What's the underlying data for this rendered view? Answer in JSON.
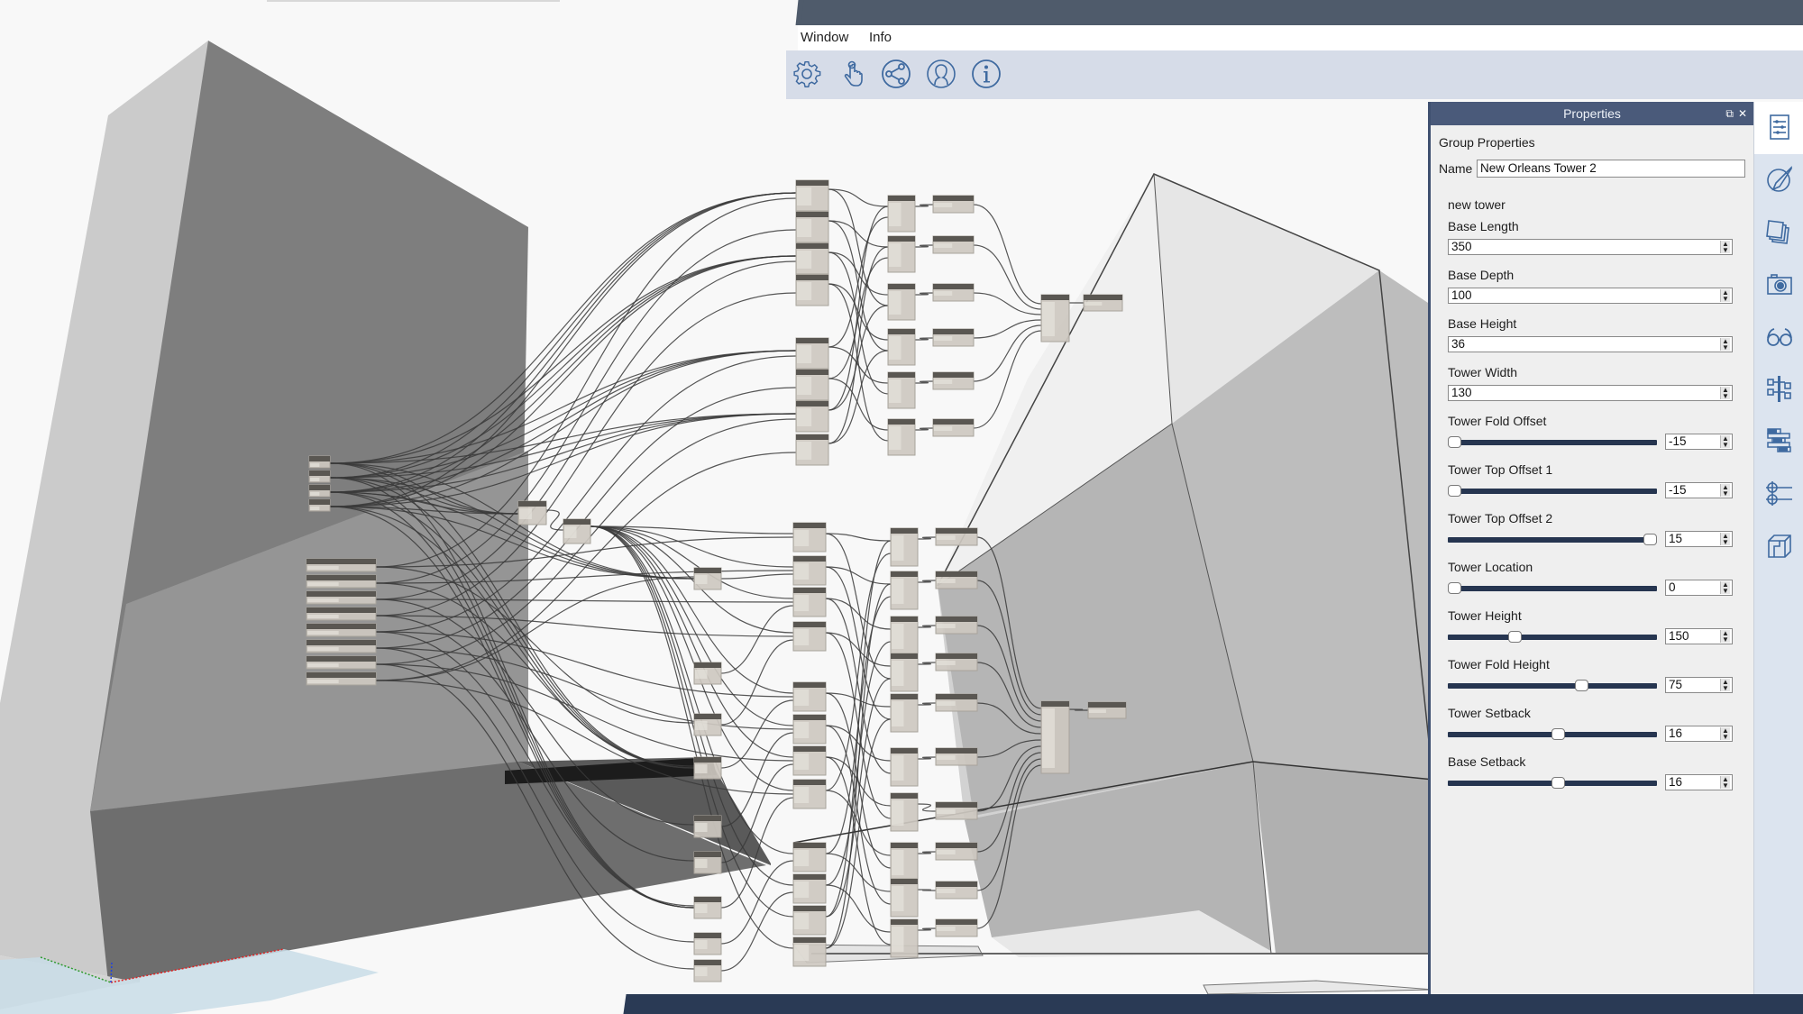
{
  "window": {
    "controls": {
      "minimize": "–",
      "restore": "❐",
      "close": "✕"
    }
  },
  "menu": {
    "items": [
      {
        "label": "Window"
      },
      {
        "label": "Info"
      }
    ]
  },
  "toolbar": {
    "icons": [
      "settings-gear-icon",
      "touch-hand-icon",
      "share-icon",
      "user-profile-icon",
      "info-icon"
    ]
  },
  "properties": {
    "title": "Properties",
    "float_label": "⧉",
    "close_label": "✕",
    "group_header": "Group Properties",
    "name_label": "Name",
    "name_value": "New Orleans Tower 2",
    "section_label": "new tower",
    "numeric_fields": [
      {
        "label": "Base Length",
        "value": "350"
      },
      {
        "label": "Base Depth",
        "value": "100"
      },
      {
        "label": "Base Height",
        "value": "36"
      },
      {
        "label": "Tower Width",
        "value": "130"
      }
    ],
    "slider_fields": [
      {
        "label": "Tower Fold Offset",
        "value": "-15",
        "position": 0.0
      },
      {
        "label": "Tower Top Offset 1",
        "value": "-15",
        "position": 0.0
      },
      {
        "label": "Tower Top Offset 2",
        "value": "15",
        "position": 1.0
      },
      {
        "label": "Tower Location",
        "value": "0",
        "position": 0.0
      },
      {
        "label": "Tower Height",
        "value": "150",
        "position": 0.31
      },
      {
        "label": "Tower Fold Height",
        "value": "75",
        "position": 0.65
      },
      {
        "label": "Tower Setback",
        "value": "16",
        "position": 0.53
      },
      {
        "label": "Base Setback",
        "value": "16",
        "position": 0.53
      }
    ]
  },
  "sidebar": {
    "items": [
      {
        "icon": "properties-sliders-icon",
        "active": true
      },
      {
        "icon": "paint-brush-icon",
        "active": false
      },
      {
        "icon": "layers-icon",
        "active": false
      },
      {
        "icon": "camera-icon",
        "active": false
      },
      {
        "icon": "glasses-icon",
        "active": false
      },
      {
        "icon": "hierarchy-tree-icon",
        "active": false
      },
      {
        "icon": "stacked-bars-icon",
        "active": false
      },
      {
        "icon": "target-points-icon",
        "active": false
      },
      {
        "icon": "solid-box-icon",
        "active": false
      }
    ]
  },
  "colors": {
    "titlebar": "#4f5b6b",
    "panel_header": "#4a5a7a",
    "slider_track": "#263550",
    "sidebar_bg": "#dce4ef",
    "accent_icon": "#3f6aa0",
    "bottombar": "#2a3a55"
  }
}
